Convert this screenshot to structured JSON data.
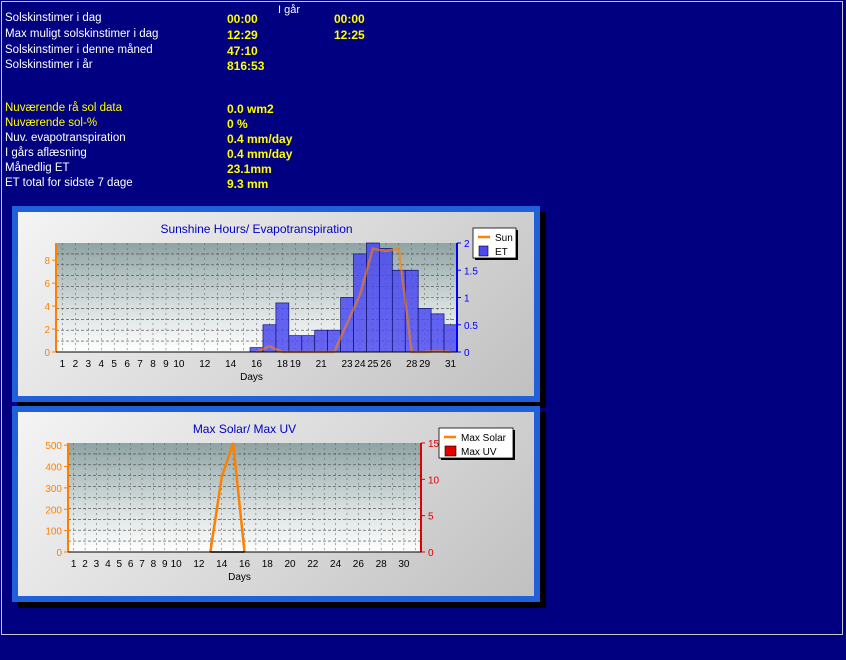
{
  "header": {
    "yesterday": "I går"
  },
  "rows": [
    {
      "label": "Solskinstimer i dag",
      "today": "00:00",
      "yesterday": "00:00"
    },
    {
      "label": "Max muligt solskinstimer i dag",
      "today": "12:29",
      "yesterday": "12:25"
    },
    {
      "label": "Solskinstimer i denne måned",
      "today": "47:10"
    },
    {
      "label": "Solskinstimer i år",
      "today": "816:53"
    }
  ],
  "rows2": [
    {
      "label": "Nuværende rå sol data",
      "value": "0.0 wm2"
    },
    {
      "label": "Nuværende sol-%",
      "value": "0 %"
    },
    {
      "label": "Nuv. evapotranspiration",
      "value": "0.4 mm/day"
    },
    {
      "label": "I gårs aflæsning",
      "value": "0.4 mm/day"
    },
    {
      "label": "Månedlig ET",
      "value": "23.1mm"
    },
    {
      "label": "ET total for sidste 7 dage",
      "value": "9.3 mm"
    }
  ],
  "colors": {
    "background": "#000080",
    "highlight": "#ffff00",
    "panel": "#2060d8",
    "sun": "#ff8000",
    "et": "#4a4af0",
    "uv": "#e00000"
  },
  "chart_data": [
    {
      "type": "bar",
      "title": "Sunshine Hours/ Evapotranspiration",
      "xlabel": "Days",
      "xticks": [
        "1",
        "2",
        "3",
        "4",
        "5",
        "6",
        "7",
        "8",
        "9",
        "10",
        "12",
        "14",
        "16",
        "18",
        "19",
        "21",
        "23",
        "24",
        "25",
        "26",
        "28",
        "29",
        "31"
      ],
      "ylim_left": [
        0,
        9.5
      ],
      "yticks_left": [
        "0",
        "2",
        "4",
        "6",
        "8"
      ],
      "ylim_right": [
        0,
        2
      ],
      "yticks_right": [
        "0",
        "0.5",
        "1",
        "1.5",
        "2"
      ],
      "legend": [
        "Sun",
        "ET"
      ],
      "legend_position": "top-right",
      "series": [
        {
          "name": "ET",
          "type": "bar",
          "axis": "right",
          "x": [
            16,
            17,
            18,
            19,
            20,
            21,
            22,
            23,
            24,
            25,
            26,
            27,
            28,
            29,
            30,
            31
          ],
          "values": [
            0.08,
            0.5,
            0.9,
            0.3,
            0.3,
            0.4,
            0.4,
            1.0,
            1.8,
            2.0,
            1.9,
            1.5,
            1.5,
            0.8,
            0.7,
            0.5
          ]
        },
        {
          "name": "Sun",
          "type": "line",
          "axis": "left",
          "x": [
            16,
            17,
            18,
            19,
            22,
            24,
            25,
            26,
            27,
            28,
            29,
            30,
            31
          ],
          "values": [
            0,
            0.5,
            0,
            0,
            0,
            5,
            9,
            8.8,
            9,
            0,
            0,
            0.1,
            0
          ]
        }
      ]
    },
    {
      "type": "line",
      "title": "Max Solar/ Max UV",
      "xlabel": "Days",
      "xticks": [
        "1",
        "2",
        "3",
        "4",
        "5",
        "6",
        "7",
        "8",
        "9",
        "10",
        "12",
        "14",
        "16",
        "18",
        "20",
        "22",
        "24",
        "26",
        "28",
        "30"
      ],
      "ylim_left": [
        0,
        510
      ],
      "yticks_left": [
        "0",
        "100",
        "200",
        "300",
        "400",
        "500"
      ],
      "ylim_right": [
        0,
        15
      ],
      "yticks_right": [
        "0",
        "5",
        "10",
        "15"
      ],
      "legend": [
        "Max Solar",
        "Max UV"
      ],
      "legend_position": "top-right",
      "series": [
        {
          "name": "Max Solar",
          "axis": "left",
          "x": [
            13,
            14,
            15,
            16
          ],
          "values": [
            0,
            350,
            510,
            0
          ]
        },
        {
          "name": "Max UV",
          "axis": "right",
          "x": [
            13,
            16
          ],
          "values": [
            0,
            0
          ]
        }
      ]
    }
  ]
}
